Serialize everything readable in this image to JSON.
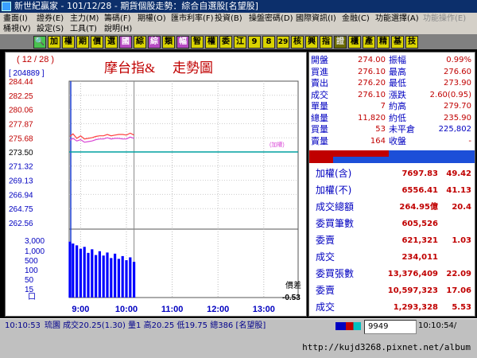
{
  "window": {
    "title": "新世紀贏家 - 101/12/28 - 期貨個股走勢：綜合自選股[名望股]"
  },
  "menu": {
    "row1": [
      "畫面(I)",
      "證券(E)",
      "主力(M)",
      "籌碼(F)",
      "期權(O)",
      "匯市利率(F)",
      "投資(B)",
      "操盤密碼(D)",
      "國際資訊(I)",
      "金融(C)",
      "功能選擇(A)",
      "功能操作(E)"
    ],
    "row2": [
      "桶視(V)",
      "設定(S)",
      "工具(T)",
      "說明(H)"
    ]
  },
  "toolbar": {
    "buttons": [
      "🔍",
      "加",
      "權",
      "期",
      "價",
      "選",
      "國",
      "綜",
      "綜",
      "類",
      "幅",
      "智",
      "權",
      "委",
      "江",
      "9",
      "8",
      "29",
      "核",
      "興",
      "指",
      "證",
      "櫃",
      "產",
      "精",
      "基",
      "技"
    ]
  },
  "chart": {
    "date_tag": "( 12 / 28 )",
    "code": "[ 204889 ]",
    "title": "摩台指&",
    "subtitle": "走勢圖",
    "price_ticks": [
      "284.44",
      "282.25",
      "280.06",
      "277.87",
      "275.68",
      "273.50",
      "271.32",
      "269.13",
      "266.94",
      "264.75",
      "262.56"
    ],
    "volume_ticks": [
      "3,000",
      "1,000",
      "500",
      "100",
      "50",
      "15"
    ],
    "volume_unit": "口",
    "time_ticks": [
      "9:00",
      "10:00",
      "11:00",
      "12:00",
      "13:00"
    ],
    "ref_label": "(加權)",
    "spread_label": "價差",
    "spread_value": "-0.53"
  },
  "chart_data": {
    "type": "line",
    "x": [
      "8:46",
      "8:50",
      "8:55",
      "9:00",
      "9:05",
      "9:10",
      "9:15",
      "9:20",
      "9:25",
      "9:30",
      "9:35",
      "9:40",
      "9:45",
      "9:50",
      "9:55",
      "10:00",
      "10:05",
      "10:10"
    ],
    "series": [
      {
        "name": "",
        "color": "#ff4040",
        "values": [
          275.9,
          276.3,
          275.6,
          276.0,
          275.5,
          275.6,
          275.7,
          275.9,
          276.0,
          276.0,
          276.2,
          276.0,
          276.1,
          276.2,
          276.2,
          276.1,
          276.4,
          276.1
        ]
      },
      {
        "name": "",
        "color": "#d946d6",
        "values": [
          275.3,
          275.6,
          275.2,
          275.4,
          275.0,
          275.1,
          275.2,
          275.4,
          275.5,
          275.5,
          275.7,
          275.5,
          275.6,
          275.6,
          275.5,
          275.5,
          275.8,
          275.6
        ]
      }
    ],
    "volume": [
      1800,
      1400,
      1100,
      700,
      900,
      400,
      650,
      300,
      500,
      280,
      420,
      200,
      360,
      180,
      260,
      150,
      220,
      120
    ],
    "ylim": [
      262.56,
      284.44
    ],
    "reference_price": 273.5,
    "xlim": [
      "8:45",
      "13:45"
    ]
  },
  "quote": {
    "rows": [
      {
        "l1": "開盤",
        "v1": "274.00",
        "l2": "振幅",
        "v2": "0.99%",
        "c2": "#c00000"
      },
      {
        "l1": "買進",
        "v1": "276.10",
        "l2": "最高",
        "v2": "276.60",
        "c2": "#c00000"
      },
      {
        "l1": "賣出",
        "v1": "276.20",
        "l2": "最低",
        "v2": "273.90",
        "c2": "#c00000"
      },
      {
        "l1": "成交",
        "v1": "276.10",
        "l2": "漲跌",
        "v2": "2.60(0.95)",
        "c2": "#c00000"
      },
      {
        "l1": "單量",
        "v1": "7",
        "l2": "約高",
        "v2": "279.70",
        "c2": "#c00000"
      },
      {
        "l1": "總量",
        "v1": "11,820",
        "l2": "約低",
        "v2": "235.90",
        "c2": "#c00000"
      },
      {
        "l1": "買量",
        "v1": "53",
        "l2": "未平倉",
        "v2": "225,802",
        "c2": "#0000c0"
      },
      {
        "l1": "賣量",
        "v1": "164",
        "l2": "收盤",
        "v2": "-",
        "c2": "#c00000"
      }
    ],
    "index_rows": [
      {
        "label": "加權(含)",
        "value": "7697.83",
        "change": "49.42"
      },
      {
        "label": "加權(不)",
        "value": "6556.41",
        "change": "41.13"
      },
      {
        "label": "成交總額",
        "value": "264.95億",
        "change": "20.4"
      },
      {
        "label": "委買筆數",
        "value": "605,526",
        "change": ""
      },
      {
        "label": "委賣",
        "value": "621,321",
        "change": "1.03"
      },
      {
        "label": "成交",
        "value": "234,011",
        "change": ""
      },
      {
        "label": "委買張數",
        "value": "13,376,409",
        "change": "22.09"
      },
      {
        "label": "委賣",
        "value": "10,597,323",
        "change": "17.06"
      },
      {
        "label": "成交",
        "value": "1,293,328",
        "change": "5.53"
      }
    ]
  },
  "status": {
    "time": "10:10:53",
    "ticker": "琉園 成交20.25(1.30) 量1 高20.25 低19.75 總386 [名望股]",
    "code": "9949",
    "clock": "10:10:54/"
  },
  "url": "http://kujd3268.pixnet.net/album",
  "colors": {
    "bg": "#000000",
    "window_title": "#0c2f6b",
    "menu": "#d4d0c8",
    "price_up": "#ff4040",
    "ref_line": "#00a0a0",
    "volume": "#0000ff"
  }
}
